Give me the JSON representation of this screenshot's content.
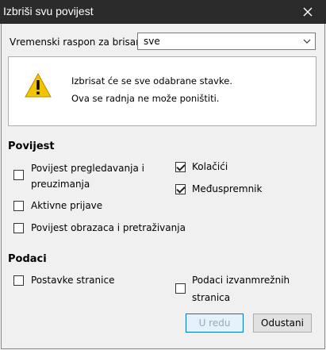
{
  "window": {
    "title": "Izbriši svu povijest"
  },
  "range": {
    "label": "Vremenski raspon za brisanje:",
    "value": "sve"
  },
  "warning": {
    "line1": "Izbrisat će se sve odabrane stavke.",
    "line2": "Ova se radnja ne može poništiti."
  },
  "history": {
    "heading": "Povijest",
    "items": [
      {
        "label_line1": "Povijest pregledavanja i",
        "label_line2": "preuzimanja",
        "checked": false
      },
      {
        "label": "Aktivne prijave",
        "checked": false
      },
      {
        "label": "Povijest obrazaca i pretraživanja",
        "checked": false
      },
      {
        "label": "Kolačići",
        "checked": true
      },
      {
        "label": "Međuspremnik",
        "checked": true
      }
    ]
  },
  "data_section": {
    "heading": "Podaci",
    "items": [
      {
        "label": "Postavke stranice",
        "checked": false
      },
      {
        "label_line1": "Podaci izvanmrežnih",
        "label_line2": "stranica",
        "checked": false
      }
    ]
  },
  "buttons": {
    "ok": "U redu",
    "cancel": "Odustani"
  },
  "colors": {
    "titlebar": "#2b2b2b",
    "accent": "#0078d7",
    "warning": "#f4c300"
  }
}
